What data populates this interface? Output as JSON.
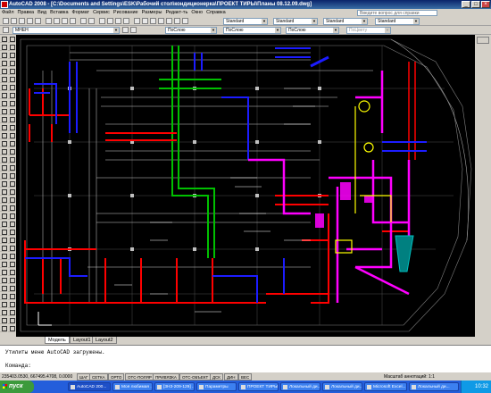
{
  "window": {
    "title": "AutoCAD 2008 - [C:\\Documents and Settings\\ESK\\Рабочий стол\\кондиционерка\\ПРОЕКТ ТИРЫ\\Планы 08.12.09.dwg]",
    "minimize": "_",
    "maximize": "□",
    "close": "×"
  },
  "menu": [
    "Файл",
    "Правка",
    "Вид",
    "Вставка",
    "Формат",
    "Сервис",
    "Рисование",
    "Размеры",
    "Редакт-ть",
    "Окно",
    "Справка"
  ],
  "help_placeholder": "Введите вопрос для справки",
  "toolbar2": {
    "style1": "Standard",
    "style2": "Standard",
    "style3": "Standard",
    "style4": "Standard"
  },
  "toolbar3": {
    "layer": "МНЕН",
    "color": "ПоСлою",
    "linetype": "ПоСлою",
    "lineweight": "ПоСлою",
    "plotstyle": "ПоЦвету"
  },
  "tabs": [
    "Модель",
    "Layout1",
    "Layout2"
  ],
  "command": {
    "line1": "Утилиты меню AutoCAD загружены.",
    "prompt": "Команда:"
  },
  "status": {
    "coords": "235403.0530, 667495.4708, 0.0000",
    "modes": [
      "ШАГ",
      "СЕТКА",
      "ОРТО",
      "ОТС-ПОЛЯР",
      "ПРИВЯЗКА",
      "ОТС-ОБЪЕКТ",
      "ДСК",
      "ДИН",
      "ВЕС"
    ],
    "scale": "Масштаб аннотаций: 1:1"
  },
  "taskbar": {
    "start": "пуск",
    "tasks": [
      "AutoCAD 200...",
      "Моя любимая ...",
      "[3Н3-209-129] ...",
      "Параметры",
      "ПРОЕКТ ТИРЫ",
      "Локальный ди...",
      "Локальный ди...",
      "Microsoft Excel...",
      "Локальный ди..."
    ],
    "clock": "10:32"
  },
  "colors": {
    "canvas": "#000000",
    "duct_red": "#ff0000",
    "duct_blue": "#1c1cff",
    "duct_magenta": "#ff00ff",
    "pipe_green": "#00c000",
    "highlight_yellow": "#ffff00",
    "accent_cyan": "#00c0c0"
  }
}
